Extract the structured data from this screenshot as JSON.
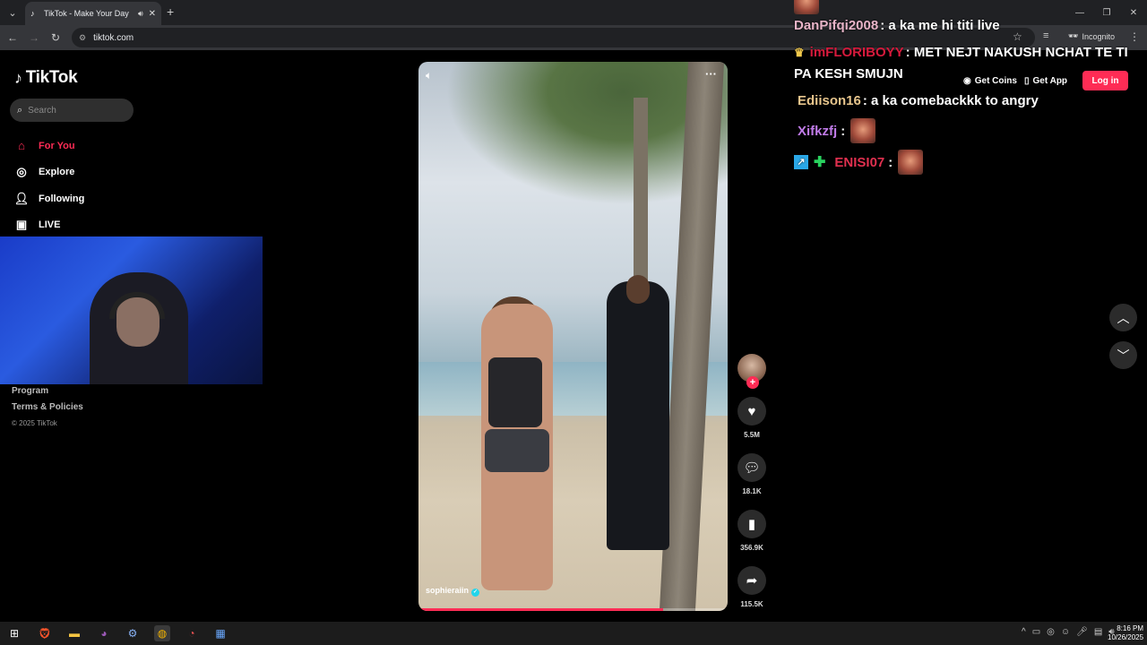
{
  "browser": {
    "tab_title": "TikTok - Make Your Day",
    "url": "tiktok.com",
    "incognito_label": "Incognito"
  },
  "sidebar": {
    "logo_text": "TikTok",
    "search_placeholder": "Search",
    "nav": [
      {
        "label": "For You",
        "icon": "home-icon",
        "active": true
      },
      {
        "label": "Explore",
        "icon": "compass-icon"
      },
      {
        "label": "Following",
        "icon": "following-icon"
      },
      {
        "label": "LIVE",
        "icon": "live-icon"
      }
    ],
    "footer": {
      "program": "Program",
      "terms": "Terms & Policies",
      "copyright": "© 2025 TikTok"
    }
  },
  "video": {
    "username": "sophieraiin",
    "progress": 0.79,
    "stats": {
      "likes": "5.5M",
      "comments": "18.1K",
      "saves": "356.9K",
      "shares": "115.5K"
    }
  },
  "header": {
    "get_coins": "Get Coins",
    "get_app": "Get App",
    "login": "Log in"
  },
  "chat": [
    {
      "user": "DanPifqi2008",
      "message": ": a ka me hi titi live"
    },
    {
      "user": "imFLORIBOYY",
      "message": ": MET NEJT NAKUSH NCHAT TE TI",
      "message2": "PA KESH SMUJN"
    },
    {
      "user": "Ediison16",
      "message": ": a ka comebackkk to angry"
    },
    {
      "user": "Xifkzfj",
      "message": ":"
    },
    {
      "user": "ENISI07",
      "message": ":"
    }
  ],
  "taskbar": {
    "time": "8:16 PM",
    "date": "10/26/2025"
  },
  "colors": {
    "accent": "#fe2c55",
    "chrome_bg": "#202124",
    "verified": "#20d5ec"
  }
}
